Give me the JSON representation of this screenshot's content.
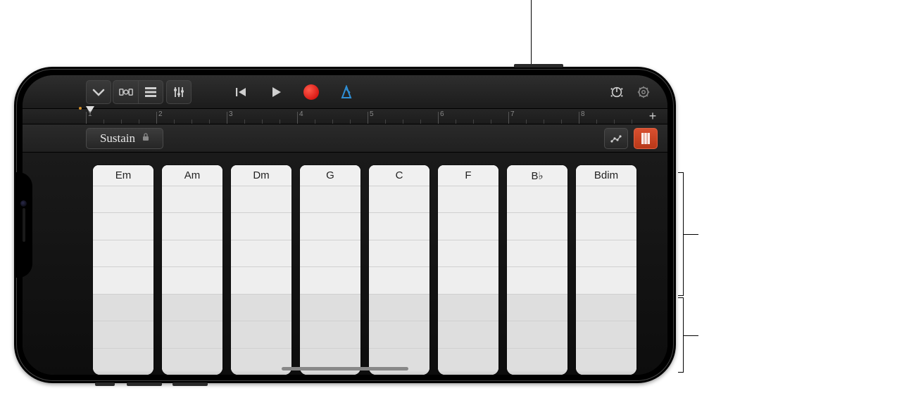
{
  "toolbar": {
    "dropdown_icon": "chevron-down",
    "browser_icon": "browser",
    "tracks_icon": "tracks",
    "mixer_icon": "mixer",
    "rewind_icon": "rewind",
    "play_icon": "play",
    "record_icon": "record",
    "metronome_icon": "metronome",
    "fx_icon": "fx-knob",
    "settings_icon": "settings"
  },
  "ruler": {
    "bars": [
      "1",
      "2",
      "3",
      "4",
      "5",
      "6",
      "7",
      "8"
    ],
    "plus": "+"
  },
  "controlrow": {
    "sustain_label": "Sustain",
    "scale_icon": "scale",
    "strips_icon": "strips"
  },
  "chords": [
    "Em",
    "Am",
    "Dm",
    "G",
    "C",
    "F",
    "B♭",
    "Bdim"
  ]
}
